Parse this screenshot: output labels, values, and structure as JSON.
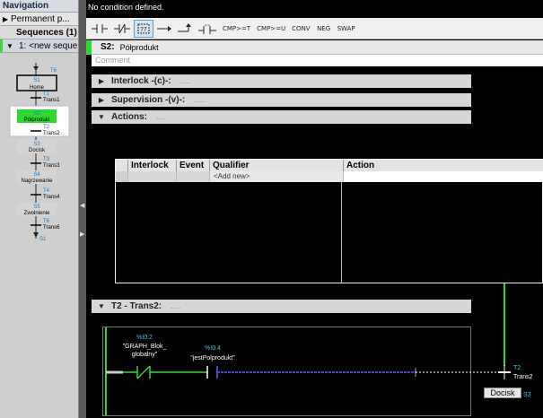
{
  "navigation": {
    "title": "Navigation",
    "permanent": "Permanent p...",
    "sequences": "Sequences (1)",
    "sequence_item": "1: <new seque"
  },
  "sequence_graph": {
    "top_jump": "T6",
    "steps": [
      {
        "id": "S1",
        "name": "Home",
        "state": "initial"
      },
      {
        "id": "S2",
        "name": "Półprodukt",
        "state": "active"
      },
      {
        "id": "S3",
        "name": "Docisk",
        "state": "normal"
      },
      {
        "id": "S4",
        "name": "Nagrzewanie",
        "state": "normal"
      },
      {
        "id": "S5",
        "name": "Zwolnienie",
        "state": "normal"
      }
    ],
    "transitions": [
      {
        "id": "T1",
        "name": "Trans1"
      },
      {
        "id": "T2",
        "name": "Trans2"
      },
      {
        "id": "T3",
        "name": "Trans3"
      },
      {
        "id": "T4",
        "name": "Trans4"
      },
      {
        "id": "T6",
        "name": "Trans6"
      }
    ],
    "bottom_jump": "S1"
  },
  "status": "No condition defined.",
  "toolbar": [
    "CMP>=T",
    "CMP>=U",
    "CONV",
    "NEG",
    "SWAP"
  ],
  "step_header": {
    "id": "S2:",
    "title": "Półprodukt"
  },
  "comment_placeholder": "Comment",
  "sections": {
    "interlock": "Interlock -(c)-:",
    "supervision": "Supervision -(v)-:",
    "actions": "Actions:",
    "transition": "T2 - Trans2:"
  },
  "actions_table": {
    "columns": [
      "Interlock",
      "Event",
      "Qualifier",
      "Action"
    ],
    "add_new": "<Add new>"
  },
  "transition_network": {
    "contact1_address": "%I0.2",
    "contact1_tag1": "\"GRAPH_Blok_",
    "contact1_tag2": "globalny\"",
    "contact2_address": "%I0.4",
    "contact2_tag": "\"jestPolprodukt\"",
    "target_transition": "T2",
    "target_name": "Trans2",
    "target_step_id": "S3",
    "next_step": "Docisk"
  },
  "colors": {
    "active_step": "#2fd82f",
    "signal": "#2fd82f",
    "address": "#40c8d8",
    "wire_blue": "#5a5aff"
  }
}
